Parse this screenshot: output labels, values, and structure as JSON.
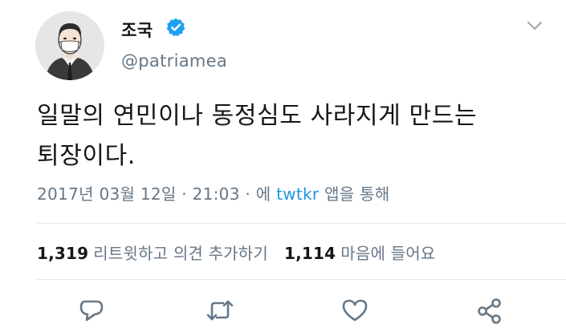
{
  "user": {
    "name": "조국",
    "handle": "@patriamea",
    "verified": true
  },
  "tweet": {
    "text_line1": "일말의 연민이나 동정심도 사라지게 만드는",
    "text_line2": "퇴장이다.",
    "timestamp": "2017년 03월 12일 · 21:03 · 에 ",
    "source": "twtkr",
    "source_suffix": " 앱을 통해"
  },
  "stats": {
    "retweets_count": "1,319",
    "retweets_label": "리트윗하고 의견 추가하기",
    "likes_count": "1,114",
    "likes_label": "마음에 들어요"
  },
  "icons": {
    "reply": "reply-icon",
    "retweet": "retweet-icon",
    "like": "heart-icon",
    "share": "share-icon",
    "verified": "verified-badge-icon",
    "menu": "chevron-down-icon"
  },
  "colors": {
    "verified": "#1da1f2",
    "link": "#1b95e0",
    "secondary_text": "#657786",
    "action_icon": "#657786"
  }
}
